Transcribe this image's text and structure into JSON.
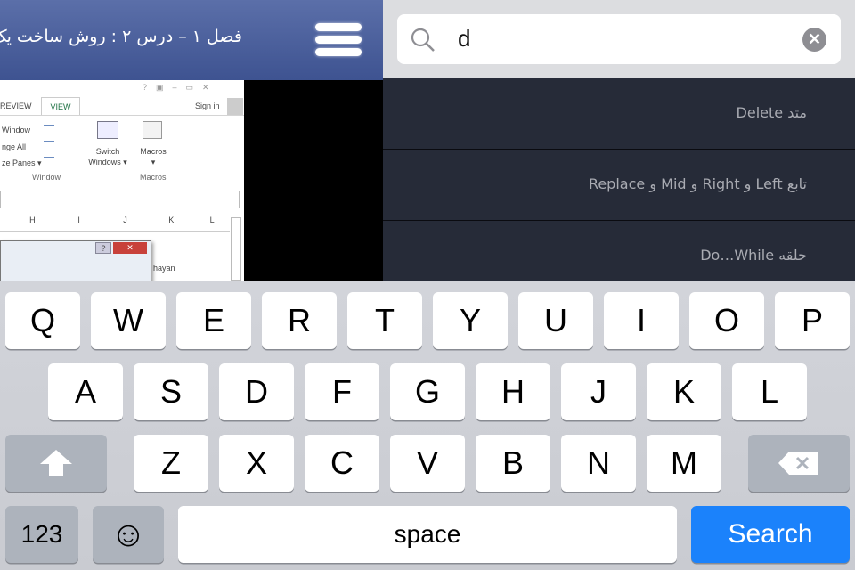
{
  "header": {
    "title": "فصل ۱ – درس ۲ : روش ساخت یک",
    "menu_icon": "hamburger-icon"
  },
  "excel": {
    "tabs": [
      "REVIEW",
      "VIEW"
    ],
    "sign_in": "Sign in",
    "window_items": [
      "Window",
      "nge All",
      "ze Panes ▾"
    ],
    "switch_windows": [
      "Switch",
      "Windows ▾"
    ],
    "macros": [
      "Macros",
      "▾"
    ],
    "groups": [
      "Window",
      "Macros"
    ],
    "columns": [
      "H",
      "I",
      "J",
      "K",
      "L"
    ],
    "cell_text": "hayan"
  },
  "search": {
    "query": "d",
    "icon": "search-icon",
    "clear_icon": "clear-icon"
  },
  "results": [
    "متد Delete",
    "تابع Left و Right و Mid و Replace",
    "حلقه Do…While"
  ],
  "keyboard": {
    "row1": [
      "Q",
      "W",
      "E",
      "R",
      "T",
      "Y",
      "U",
      "I",
      "O",
      "P"
    ],
    "row2": [
      "A",
      "S",
      "D",
      "F",
      "G",
      "H",
      "J",
      "K",
      "L"
    ],
    "row3": [
      "Z",
      "X",
      "C",
      "V",
      "B",
      "N",
      "M"
    ],
    "numbers": "123",
    "emoji": "☺",
    "space": "space",
    "search": "Search",
    "accent": "#1b82fb"
  }
}
